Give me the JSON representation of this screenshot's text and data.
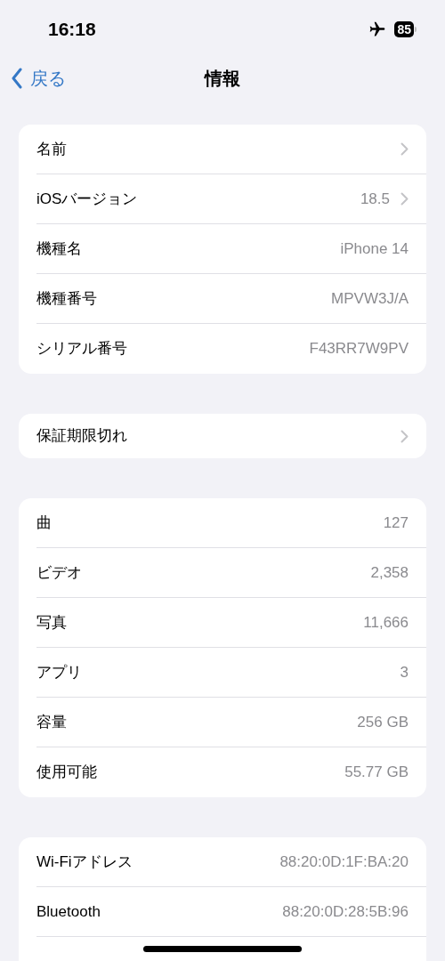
{
  "status_bar": {
    "time": "16:18",
    "airplane_mode": true,
    "battery": "85"
  },
  "nav": {
    "back": "戻る",
    "title": "情報"
  },
  "groups": [
    {
      "rows": [
        {
          "label": "名前",
          "disclosure": true
        },
        {
          "label": "iOSバージョン",
          "value": "18.5",
          "disclosure": true
        },
        {
          "label": "機種名",
          "value": "iPhone 14",
          "disclosure": false
        },
        {
          "label": "機種番号",
          "value": "MPVW3J/A",
          "disclosure": false
        },
        {
          "label": "シリアル番号",
          "value": "F43RR7W9PV",
          "disclosure": false
        }
      ]
    },
    {
      "rows": [
        {
          "label": "保証期限切れ",
          "disclosure": true
        }
      ]
    },
    {
      "rows": [
        {
          "label": "曲",
          "value": "127",
          "disclosure": false
        },
        {
          "label": "ビデオ",
          "value": "2,358",
          "disclosure": false
        },
        {
          "label": "写真",
          "value": "11,666",
          "disclosure": false
        },
        {
          "label": "アプリ",
          "value": "3",
          "disclosure": false
        },
        {
          "label": "容量",
          "value": "256 GB",
          "disclosure": false
        },
        {
          "label": "使用可能",
          "value": "55.77 GB",
          "disclosure": false
        }
      ]
    },
    {
      "rows": [
        {
          "label": "Wi-Fiアドレス",
          "value": "88:20:0D:1F:BA:20",
          "disclosure": false
        },
        {
          "label": "Bluetooth",
          "value": "88:20:0D:28:5B:96",
          "disclosure": false
        }
      ],
      "continues": true
    }
  ]
}
